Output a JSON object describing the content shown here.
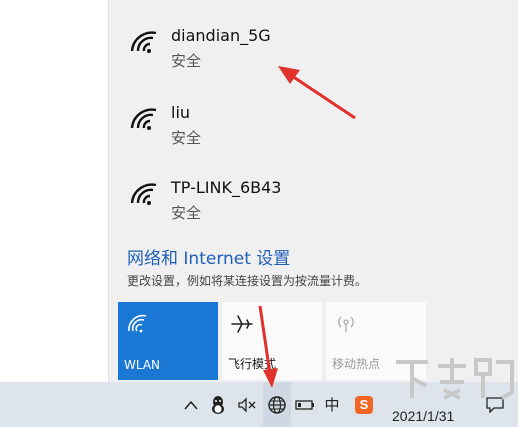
{
  "networks": [
    {
      "name": "diandian_5G",
      "security": "安全",
      "icon": "wifi-icon"
    },
    {
      "name": "liu",
      "security": "安全",
      "icon": "wifi-icon"
    },
    {
      "name": "TP-LINK_6B43",
      "security": "安全",
      "icon": "wifi-icon"
    }
  ],
  "settings": {
    "link_label": "网络和 Internet 设置",
    "description": "更改设置，例如将某连接设置为按流量计费。"
  },
  "quick_actions": {
    "wlan": {
      "label": "WLAN",
      "icon": "wifi-icon"
    },
    "airplane": {
      "label": "飞行模式",
      "icon": "airplane-icon"
    },
    "hotspot": {
      "label": "移动热点",
      "icon": "hotspot-icon"
    }
  },
  "taskbar": {
    "chevron": "^",
    "ime": "中",
    "ime_brand": "S",
    "date": "2021/1/31"
  },
  "colors": {
    "accent": "#1a78d4",
    "link": "#1f5fb8",
    "annotation_arrow": "#e0312b",
    "ime_brand": "#f26522"
  }
}
